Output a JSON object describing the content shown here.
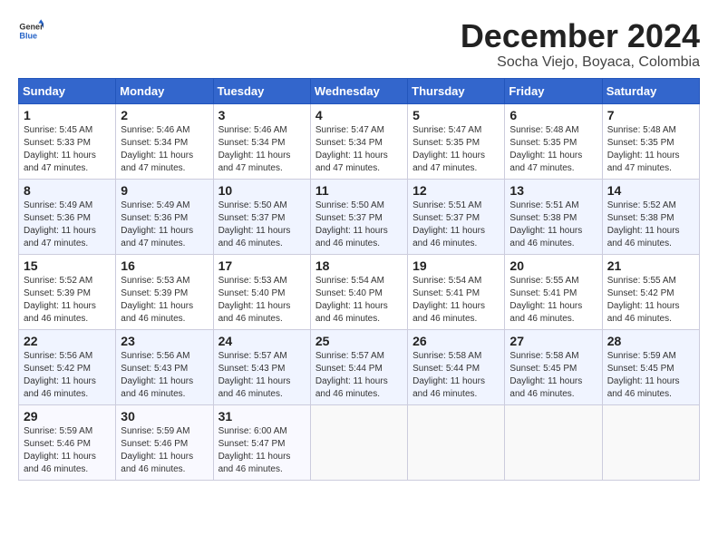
{
  "logo": {
    "general": "General",
    "blue": "Blue"
  },
  "title": "December 2024",
  "subtitle": "Socha Viejo, Boyaca, Colombia",
  "days_of_week": [
    "Sunday",
    "Monday",
    "Tuesday",
    "Wednesday",
    "Thursday",
    "Friday",
    "Saturday"
  ],
  "weeks": [
    [
      {
        "day": "1",
        "sunrise": "5:45 AM",
        "sunset": "5:33 PM",
        "daylight": "11 hours and 47 minutes."
      },
      {
        "day": "2",
        "sunrise": "5:46 AM",
        "sunset": "5:34 PM",
        "daylight": "11 hours and 47 minutes."
      },
      {
        "day": "3",
        "sunrise": "5:46 AM",
        "sunset": "5:34 PM",
        "daylight": "11 hours and 47 minutes."
      },
      {
        "day": "4",
        "sunrise": "5:47 AM",
        "sunset": "5:34 PM",
        "daylight": "11 hours and 47 minutes."
      },
      {
        "day": "5",
        "sunrise": "5:47 AM",
        "sunset": "5:35 PM",
        "daylight": "11 hours and 47 minutes."
      },
      {
        "day": "6",
        "sunrise": "5:48 AM",
        "sunset": "5:35 PM",
        "daylight": "11 hours and 47 minutes."
      },
      {
        "day": "7",
        "sunrise": "5:48 AM",
        "sunset": "5:35 PM",
        "daylight": "11 hours and 47 minutes."
      }
    ],
    [
      {
        "day": "8",
        "sunrise": "5:49 AM",
        "sunset": "5:36 PM",
        "daylight": "11 hours and 47 minutes."
      },
      {
        "day": "9",
        "sunrise": "5:49 AM",
        "sunset": "5:36 PM",
        "daylight": "11 hours and 47 minutes."
      },
      {
        "day": "10",
        "sunrise": "5:50 AM",
        "sunset": "5:37 PM",
        "daylight": "11 hours and 46 minutes."
      },
      {
        "day": "11",
        "sunrise": "5:50 AM",
        "sunset": "5:37 PM",
        "daylight": "11 hours and 46 minutes."
      },
      {
        "day": "12",
        "sunrise": "5:51 AM",
        "sunset": "5:37 PM",
        "daylight": "11 hours and 46 minutes."
      },
      {
        "day": "13",
        "sunrise": "5:51 AM",
        "sunset": "5:38 PM",
        "daylight": "11 hours and 46 minutes."
      },
      {
        "day": "14",
        "sunrise": "5:52 AM",
        "sunset": "5:38 PM",
        "daylight": "11 hours and 46 minutes."
      }
    ],
    [
      {
        "day": "15",
        "sunrise": "5:52 AM",
        "sunset": "5:39 PM",
        "daylight": "11 hours and 46 minutes."
      },
      {
        "day": "16",
        "sunrise": "5:53 AM",
        "sunset": "5:39 PM",
        "daylight": "11 hours and 46 minutes."
      },
      {
        "day": "17",
        "sunrise": "5:53 AM",
        "sunset": "5:40 PM",
        "daylight": "11 hours and 46 minutes."
      },
      {
        "day": "18",
        "sunrise": "5:54 AM",
        "sunset": "5:40 PM",
        "daylight": "11 hours and 46 minutes."
      },
      {
        "day": "19",
        "sunrise": "5:54 AM",
        "sunset": "5:41 PM",
        "daylight": "11 hours and 46 minutes."
      },
      {
        "day": "20",
        "sunrise": "5:55 AM",
        "sunset": "5:41 PM",
        "daylight": "11 hours and 46 minutes."
      },
      {
        "day": "21",
        "sunrise": "5:55 AM",
        "sunset": "5:42 PM",
        "daylight": "11 hours and 46 minutes."
      }
    ],
    [
      {
        "day": "22",
        "sunrise": "5:56 AM",
        "sunset": "5:42 PM",
        "daylight": "11 hours and 46 minutes."
      },
      {
        "day": "23",
        "sunrise": "5:56 AM",
        "sunset": "5:43 PM",
        "daylight": "11 hours and 46 minutes."
      },
      {
        "day": "24",
        "sunrise": "5:57 AM",
        "sunset": "5:43 PM",
        "daylight": "11 hours and 46 minutes."
      },
      {
        "day": "25",
        "sunrise": "5:57 AM",
        "sunset": "5:44 PM",
        "daylight": "11 hours and 46 minutes."
      },
      {
        "day": "26",
        "sunrise": "5:58 AM",
        "sunset": "5:44 PM",
        "daylight": "11 hours and 46 minutes."
      },
      {
        "day": "27",
        "sunrise": "5:58 AM",
        "sunset": "5:45 PM",
        "daylight": "11 hours and 46 minutes."
      },
      {
        "day": "28",
        "sunrise": "5:59 AM",
        "sunset": "5:45 PM",
        "daylight": "11 hours and 46 minutes."
      }
    ],
    [
      {
        "day": "29",
        "sunrise": "5:59 AM",
        "sunset": "5:46 PM",
        "daylight": "11 hours and 46 minutes."
      },
      {
        "day": "30",
        "sunrise": "5:59 AM",
        "sunset": "5:46 PM",
        "daylight": "11 hours and 46 minutes."
      },
      {
        "day": "31",
        "sunrise": "6:00 AM",
        "sunset": "5:47 PM",
        "daylight": "11 hours and 46 minutes."
      },
      null,
      null,
      null,
      null
    ]
  ],
  "labels": {
    "sunrise": "Sunrise: ",
    "sunset": "Sunset: ",
    "daylight": "Daylight hours"
  }
}
